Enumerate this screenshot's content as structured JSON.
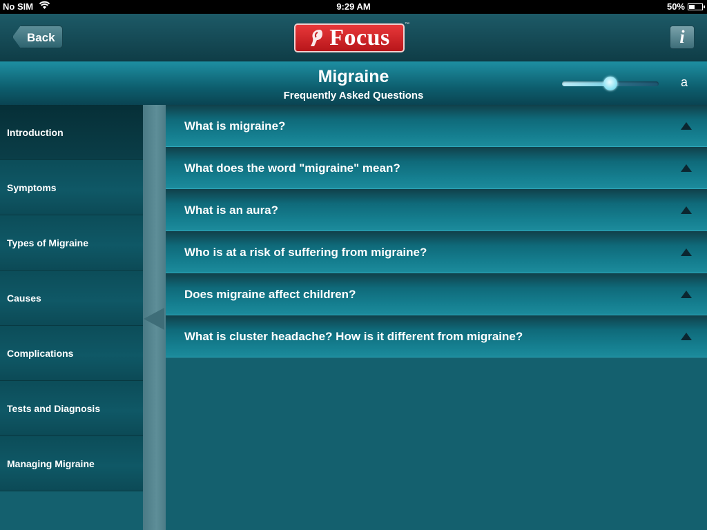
{
  "status_bar": {
    "carrier": "No SIM",
    "time": "9:29 AM",
    "battery_text": "50%",
    "battery_level": 0.5
  },
  "navbar": {
    "back_label": "Back",
    "logo_text": "Focus",
    "logo_tm": "™",
    "info_label": "i"
  },
  "header": {
    "title": "Migraine",
    "subtitle": "Frequently Asked Questions",
    "font_size_label": "a",
    "font_slider_value": 0.5
  },
  "sidebar": {
    "items": [
      {
        "label": "Introduction",
        "active": true
      },
      {
        "label": "Symptoms",
        "active": false
      },
      {
        "label": "Types of Migraine",
        "active": false
      },
      {
        "label": "Causes",
        "active": false
      },
      {
        "label": "Complications",
        "active": false
      },
      {
        "label": "Tests and Diagnosis",
        "active": false
      },
      {
        "label": "Managing Migraine",
        "active": false
      }
    ]
  },
  "faq": {
    "questions": [
      "What is migraine?",
      "What does the word \"migraine\" mean?",
      "What is an aura?",
      "Who is at a risk of suffering from migraine?",
      "Does migraine affect children?",
      "What is cluster headache? How is it different from migraine?"
    ]
  },
  "colors": {
    "accent": "#1c8b9c",
    "logo_red": "#d42628",
    "background": "#14606e"
  }
}
